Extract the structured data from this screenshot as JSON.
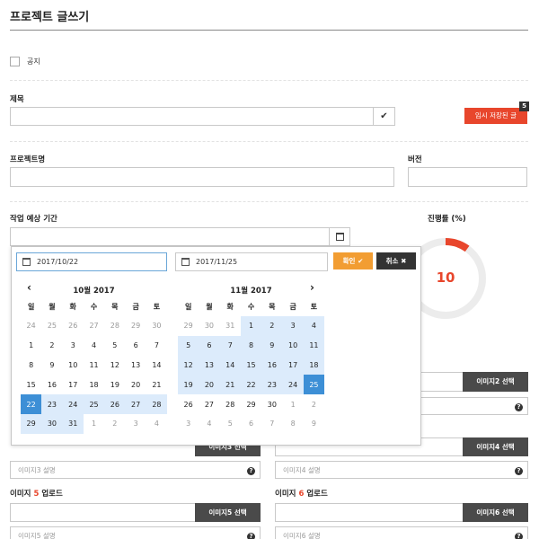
{
  "page": {
    "title": "프로젝트 글쓰기"
  },
  "notice": {
    "label": "공지",
    "checked": false
  },
  "subject": {
    "label": "제목",
    "value": ""
  },
  "temp_save": {
    "label": "임시 저장된 글",
    "count": "5",
    "color": "#e8462c"
  },
  "project_name": {
    "label": "프로젝트명",
    "value": ""
  },
  "version": {
    "label": "버전",
    "value": ""
  },
  "period": {
    "label": "작업 예상 기간",
    "value": ""
  },
  "progress": {
    "label": "진행률 (%)",
    "value": "10",
    "fraction": 0.1,
    "color": "#e8462c"
  },
  "daterange": {
    "start": "2017/10/22",
    "end": "2017/11/25",
    "confirm_label": "확인",
    "cancel_label": "취소",
    "weekdays": [
      "일",
      "월",
      "화",
      "수",
      "목",
      "금",
      "토"
    ],
    "left_title": "10월 2017",
    "right_title": "11월 2017",
    "left_weeks": [
      [
        "24",
        "25",
        "26",
        "27",
        "28",
        "29",
        "30"
      ],
      [
        "1",
        "2",
        "3",
        "4",
        "5",
        "6",
        "7"
      ],
      [
        "8",
        "9",
        "10",
        "11",
        "12",
        "13",
        "14"
      ],
      [
        "15",
        "16",
        "17",
        "18",
        "19",
        "20",
        "21"
      ],
      [
        "22",
        "23",
        "24",
        "25",
        "26",
        "27",
        "28"
      ],
      [
        "29",
        "30",
        "31",
        "1",
        "2",
        "3",
        "4"
      ]
    ],
    "right_weeks": [
      [
        "29",
        "30",
        "31",
        "1",
        "2",
        "3",
        "4"
      ],
      [
        "5",
        "6",
        "7",
        "8",
        "9",
        "10",
        "11"
      ],
      [
        "12",
        "13",
        "14",
        "15",
        "16",
        "17",
        "18"
      ],
      [
        "19",
        "20",
        "21",
        "22",
        "23",
        "24",
        "25"
      ],
      [
        "26",
        "27",
        "28",
        "29",
        "30",
        "1",
        "2"
      ],
      [
        "3",
        "4",
        "5",
        "6",
        "7",
        "8",
        "9"
      ]
    ]
  },
  "images": {
    "img2_button": "이미지2 선택",
    "img3_button": "이미지3 선택",
    "img3_desc_placeholder": "이미지3 설명",
    "img4_button": "이미지4 선택",
    "img4_desc_placeholder": "이미지4 설명",
    "img5_label_prefix": "이미지",
    "img5_num": "5",
    "img5_label_suffix": "업로드",
    "img5_button": "이미지5 선택",
    "img5_desc_placeholder": "이미지5 설명",
    "img6_label_prefix": "이미지",
    "img6_num": "6",
    "img6_label_suffix": "업로드",
    "img6_button": "이미지6 선택",
    "img6_desc_placeholder": "이미지6 설명",
    "help_glyph": "?"
  }
}
